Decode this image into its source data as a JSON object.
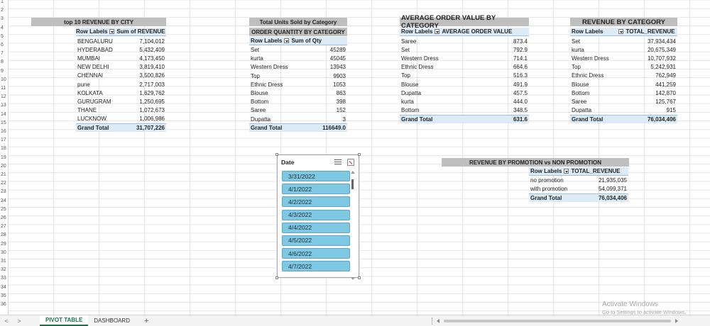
{
  "rows": [
    "1",
    "2",
    "3",
    "4",
    "5",
    "6",
    "7",
    "8",
    "9",
    "10",
    "11",
    "12",
    "13",
    "14",
    "15",
    "16",
    "17",
    "18",
    "19",
    "20",
    "21",
    "22",
    "23",
    "24",
    "25",
    "26",
    "27",
    "28",
    "29",
    "30",
    "31",
    "32",
    "33",
    "34",
    "35",
    "36"
  ],
  "city": {
    "title": "top 10 REVENUE BY CITY",
    "col1": "Row Labels",
    "col2": "Sum of REVENUE",
    "items": [
      {
        "label": "BENGALURU",
        "value": "7,104,012"
      },
      {
        "label": "HYDERABAD",
        "value": "5,432,409"
      },
      {
        "label": "MUMBAI",
        "value": "4,173,450"
      },
      {
        "label": "NEW DELHI",
        "value": "3,819,410"
      },
      {
        "label": "CHENNAI",
        "value": "3,500,826"
      },
      {
        "label": "pune",
        "value": "2,717,003"
      },
      {
        "label": "KOLKATA",
        "value": "1,629,762"
      },
      {
        "label": "GURUGRAM",
        "value": "1,250,695"
      },
      {
        "label": "THANE",
        "value": "1,072,673"
      },
      {
        "label": "LUCKNOW",
        "value": "1,006,986"
      }
    ],
    "total_label": "Grand Total",
    "total_value": "31,707,226"
  },
  "qty": {
    "title1": "Total Units Sold by Category",
    "title2": "ORDER QUANTITY BY CATEGORY",
    "col1": "Row Labels",
    "col2": "Sum of Qty",
    "items": [
      {
        "label": "Set",
        "value": "45289"
      },
      {
        "label": "kurta",
        "value": "45045"
      },
      {
        "label": "Western Dress",
        "value": "13943"
      },
      {
        "label": "Top",
        "value": "9903"
      },
      {
        "label": "Ethnic Dress",
        "value": "1053"
      },
      {
        "label": "Blouse",
        "value": "863"
      },
      {
        "label": "Bottom",
        "value": "398"
      },
      {
        "label": "Saree",
        "value": "152"
      },
      {
        "label": "Dupatta",
        "value": "3"
      }
    ],
    "total_label": "Grand Total",
    "total_value": "116649.0"
  },
  "aov": {
    "title": "AVERAGE ORDER VALUE BY CATEGORY",
    "col1": "Row Labels",
    "col2": "AVERAGE ORDER VALUE",
    "items": [
      {
        "label": "Saree",
        "value": "873.4"
      },
      {
        "label": "Set",
        "value": "792.9"
      },
      {
        "label": "Western Dress",
        "value": "714.1"
      },
      {
        "label": "Ethnic Dress",
        "value": "664.6"
      },
      {
        "label": "Top",
        "value": "516.3"
      },
      {
        "label": "Blouse",
        "value": "491.9"
      },
      {
        "label": "Dupatta",
        "value": "457.5"
      },
      {
        "label": "kurta",
        "value": "444.0"
      },
      {
        "label": "Bottom",
        "value": "348.5"
      }
    ],
    "total_label": "Grand Total",
    "total_value": "631.6"
  },
  "revcat": {
    "title": "REVENUE BY CATEGORY",
    "col1": "Row Labels",
    "col2": "TOTAL_REVENUE",
    "items": [
      {
        "label": "Set",
        "value": "37,934,434"
      },
      {
        "label": "kurta",
        "value": "20,675,349"
      },
      {
        "label": "Western Dress",
        "value": "10,707,932"
      },
      {
        "label": "Top",
        "value": "5,242,931"
      },
      {
        "label": "Ethnic Dress",
        "value": "762,949"
      },
      {
        "label": "Blouse",
        "value": "441,259"
      },
      {
        "label": "Bottom",
        "value": "142,870"
      },
      {
        "label": "Saree",
        "value": "125,767"
      },
      {
        "label": "Dupatta",
        "value": "915"
      }
    ],
    "total_label": "Grand Total",
    "total_value": "76,034,406"
  },
  "promo": {
    "title": "REVENUE BY PROMOTION vs NON PROMOTION",
    "col1": "Row Labels",
    "col2": "TOTAL_REVENUE",
    "items": [
      {
        "label": "no promotion",
        "value": "21,935,035"
      },
      {
        "label": "with promotion",
        "value": "54,099,371"
      }
    ],
    "total_label": "Grand Total",
    "total_value": "76,034,406"
  },
  "slicer": {
    "title": "Date",
    "items": [
      "3/31/2022",
      "4/1/2022",
      "4/2/2022",
      "4/3/2022",
      "4/4/2022",
      "4/5/2022",
      "4/6/2022",
      "4/7/2022"
    ]
  },
  "tabs": {
    "prev": "<",
    "next": ">",
    "active": "PIVOT TABLE",
    "other": "DASHBOARD",
    "add": "+"
  },
  "watermark": {
    "line1": "Activate Windows",
    "line2": "Go to Settings to activate Windows."
  }
}
